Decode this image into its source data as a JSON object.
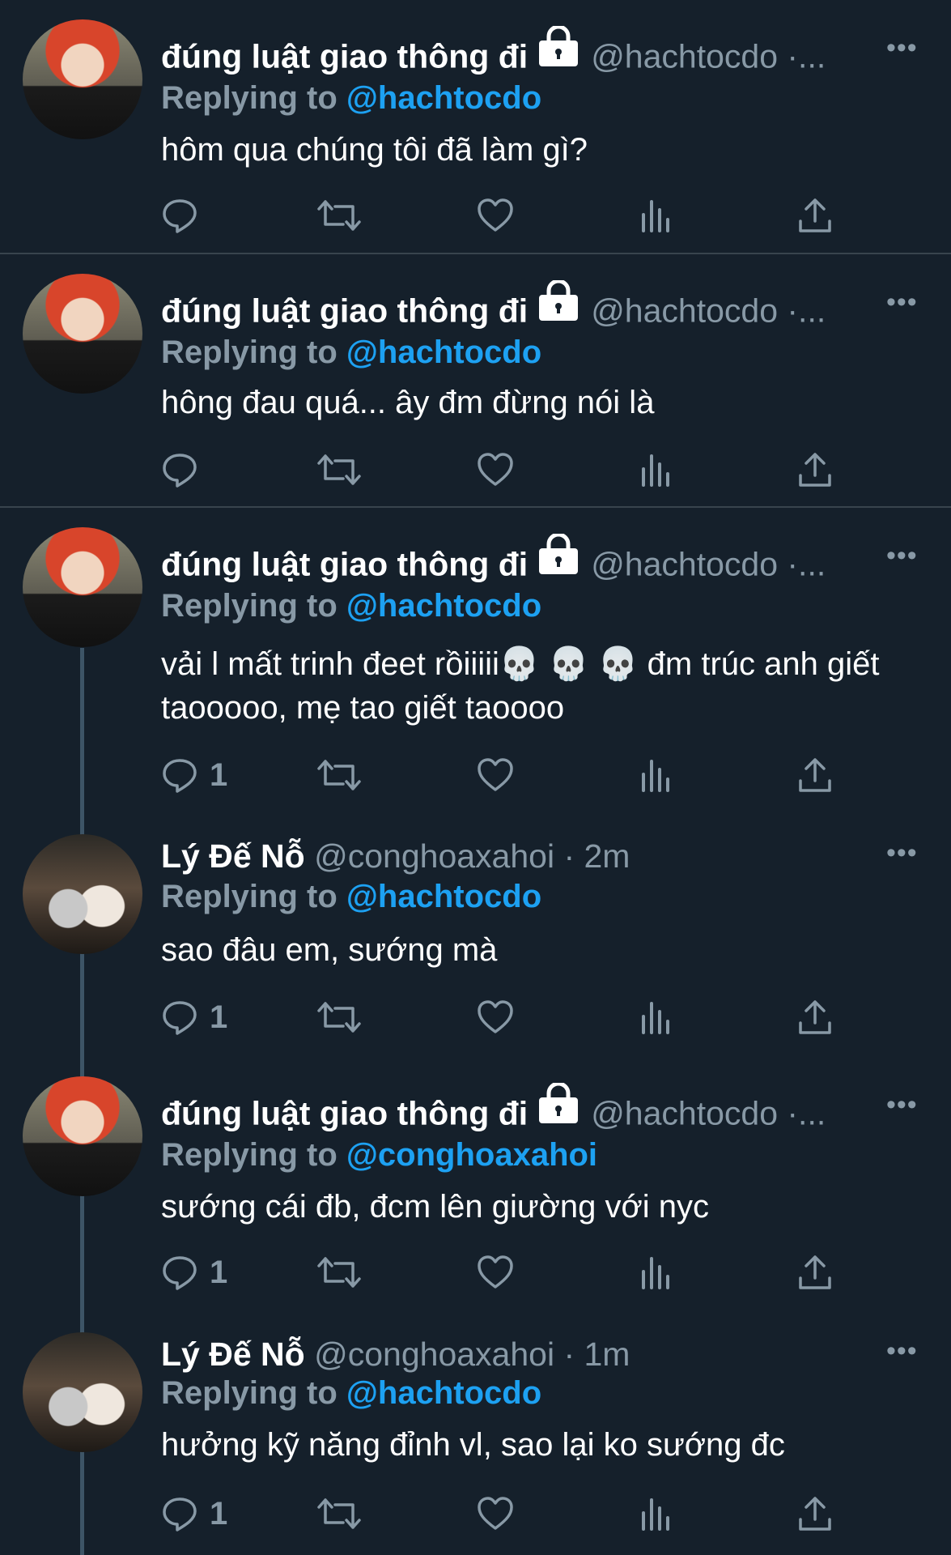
{
  "tweets": [
    {
      "name": "đúng luật giao thông đi",
      "handle": "@hachtocdo ·...",
      "replying_label": "Replying to",
      "replying_to": "@hachtocdo",
      "text": "hôm qua chúng tôi đã làm gì?",
      "reply_count": "",
      "avatar": "red-hair-avatar",
      "locked": true
    },
    {
      "name": "đúng luật giao thông đi",
      "handle": "@hachtocdo ·...",
      "replying_label": "Replying to",
      "replying_to": "@hachtocdo",
      "text": "hông đau quá... ây đm đừng nói là",
      "reply_count": "",
      "avatar": "red-hair-avatar",
      "locked": true
    },
    {
      "name": "đúng luật giao thông đi",
      "handle": "@hachtocdo ·...",
      "replying_label": "Replying to",
      "replying_to": "@hachtocdo",
      "text": "vải l mất trinh đeet rồiiiii💀 💀 💀  đm trúc anh giết taooooo, mẹ tao giết taoooo",
      "reply_count": "1",
      "avatar": "red-hair-avatar",
      "locked": true
    },
    {
      "name": "Lý Đế Nỗ",
      "handle": "@conghoaxahoi · 2m",
      "replying_label": "Replying to",
      "replying_to": "@hachtocdo",
      "text": "sao đâu em, sướng mà",
      "reply_count": "1",
      "avatar": "couple-avatar",
      "locked": false
    },
    {
      "name": "đúng luật giao thông đi",
      "handle": "@hachtocdo ·...",
      "replying_label": "Replying to",
      "replying_to": "@conghoaxahoi",
      "text": "sướng cái đb, đcm lên giường với nyc",
      "reply_count": "1",
      "avatar": "red-hair-avatar",
      "locked": true
    },
    {
      "name": "Lý Đế Nỗ",
      "handle": "@conghoaxahoi · 1m",
      "replying_label": "Replying to",
      "replying_to": "@hachtocdo",
      "text": "hưởng kỹ năng đỉnh vl, sao lại ko sướng đc",
      "reply_count": "1",
      "avatar": "couple-avatar",
      "locked": false
    }
  ],
  "more_glyph": "•••",
  "colors": {
    "background": "#15202b",
    "secondary_text": "#8899a6",
    "mention": "#1da1f2",
    "divider": "#38444d"
  }
}
